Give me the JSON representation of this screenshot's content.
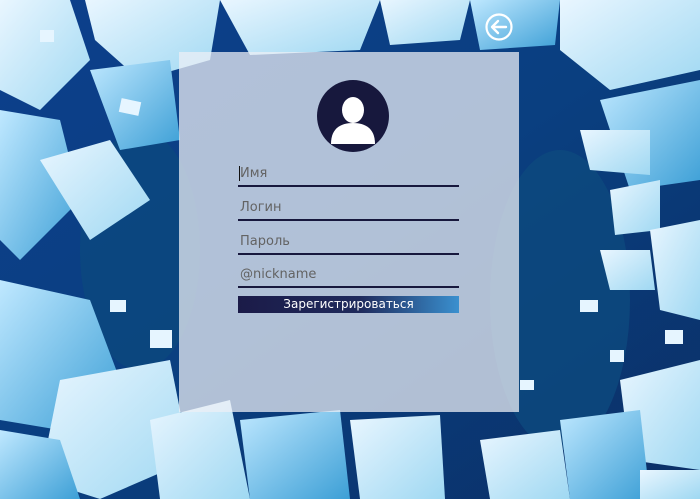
{
  "form": {
    "name_placeholder": "Имя",
    "login_placeholder": "Логин",
    "password_placeholder": "Пароль",
    "nickname_placeholder": "@nickname",
    "submit_label": "Зарегистрироваться"
  },
  "icons": {
    "back": "arrow-left-circle-icon",
    "avatar": "user-silhouette-icon"
  },
  "colors": {
    "accent_dark": "#17183d",
    "button_gradient_end": "#3a90cf",
    "panel": "#eceff6"
  }
}
